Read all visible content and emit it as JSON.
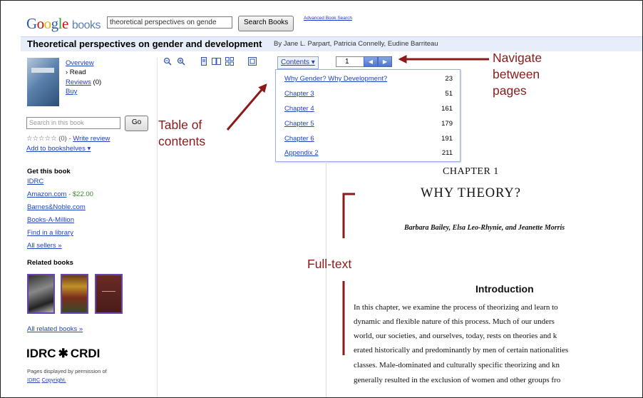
{
  "header": {
    "logo_google": [
      "G",
      "o",
      "o",
      "g",
      "l",
      "e"
    ],
    "logo_books": "books",
    "search_value": "theoretical perspectives on gende",
    "search_button": "Search Books",
    "advanced_link": "Advanced Book Search"
  },
  "book": {
    "title": "Theoretical perspectives on gender and development",
    "authors": "By Jane L. Parpart, Patricia Connelly, Eudine Barriteau"
  },
  "sidebar": {
    "overview": "Overview",
    "read": "› Read",
    "reviews": "Reviews",
    "reviews_count": "(0)",
    "buy": "Buy",
    "search_placeholder": "Search in this book",
    "go_button": "Go",
    "rating_stars": "☆☆☆☆☆",
    "rating_count": "(0) -",
    "write_review": "Write review",
    "add_to_shelves": "Add to bookshelves ▾",
    "get_this_book": "Get this book",
    "idrc": "IDRC",
    "amazon": "Amazon.com",
    "amazon_price": "- $22.00",
    "bn": "Barnes&Noble.com",
    "bam": "Books-A-Million",
    "library": "Find in a library",
    "all_sellers": "All sellers »",
    "related_books": "Related books",
    "all_related": "All related books »",
    "logo_left": "IDRC",
    "logo_right": "CRDI",
    "permission_note": "Pages displayed by permission of",
    "idrc_link": "IDRC",
    "copyright": "Copyright."
  },
  "toolbar": {
    "contents_label": "Contents ▾",
    "page_number": "1",
    "prev_arrow": "◀",
    "next_arrow": "▶"
  },
  "toc": [
    {
      "label": "Why Gender? Why Development?",
      "page": "23"
    },
    {
      "label": "Chapter 3",
      "page": "51"
    },
    {
      "label": "Chapter 4",
      "page": "161"
    },
    {
      "label": "Chapter 5",
      "page": "179"
    },
    {
      "label": "Chapter 6",
      "page": "191"
    },
    {
      "label": "Appendix 2",
      "page": "211"
    }
  ],
  "page": {
    "chapter_label": "CHAPTER 1",
    "chapter_title": "WHY THEORY?",
    "chapter_authors": "Barbara Bailey, Elsa Leo-Rhynie, and Jeanette Morris",
    "intro_heading": "Introduction",
    "body_lines": [
      "In this chapter, we examine the process of theorizing and learn to",
      "dynamic and flexible nature of this process. Much of our unders",
      "world, our societies, and ourselves, today, rests on theories and k",
      "erated historically and predominantly by men of certain nationalities",
      "classes. Male-dominated and culturally specific theorizing and kn",
      "generally resulted in the exclusion of women and other groups fro"
    ]
  },
  "annotations": {
    "navigate": [
      "Navigate",
      "between",
      "pages"
    ],
    "toc": [
      "Table of",
      "contents"
    ],
    "fulltext": "Full-text"
  },
  "colors": {
    "annotation": "#8b1a1a",
    "link": "#2244bb",
    "title_bar": "#e8eef9"
  }
}
